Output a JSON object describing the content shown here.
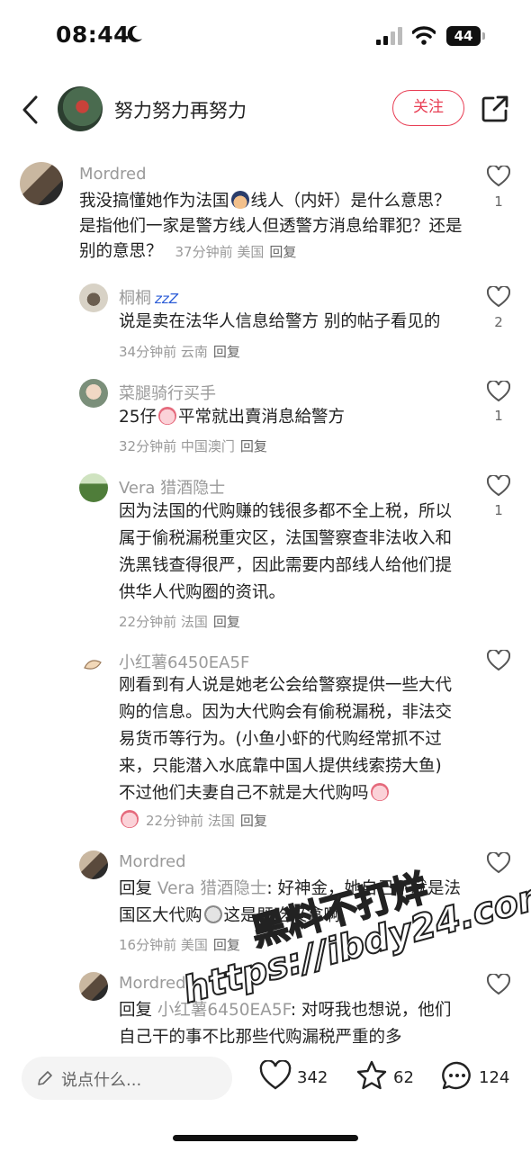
{
  "status": {
    "time": "08:44",
    "battery": "44"
  },
  "header": {
    "name": "努力努力再努力",
    "follow": "关注"
  },
  "comments": [
    {
      "name": "Mordred",
      "text": "我没搞懂她作为法国",
      "text_b": "线人（内奸）是什么意思？是指他们一家是警方线人但透警方消息给罪犯？还是别的意思？",
      "time": "37分钟前",
      "loc": "美国",
      "reply": "回复",
      "likes": "1"
    },
    {
      "name": "桐桐",
      "text": "说是卖在法华人信息给警方 别的帖子看见的",
      "time": "34分钟前",
      "loc": "云南",
      "reply": "回复",
      "likes": "2"
    },
    {
      "name": "菜腿骑行买手",
      "text": "25仔",
      "text_b": "平常就出賣消息給警方",
      "time": "32分钟前",
      "loc": "中国澳门",
      "reply": "回复",
      "likes": "1"
    },
    {
      "name": "Vera 猎酒隐士",
      "text": "因为法国的代购赚的钱很多都不全上税，所以属于偷税漏税重灾区，法国警察查非法收入和洗黑钱查得很严，因此需要内部线人给他们提供华人代购圈的资讯。",
      "time": "22分钟前",
      "loc": "法国",
      "reply": "回复",
      "likes": "1"
    },
    {
      "name": "小红薯6450EA5F",
      "text": "刚看到有人说是她老公会给警察提供一些大代购的信息。因为大代购会有偷税漏税，非法交易货币等行为。(小鱼小虾的代购经常抓不过来，只能潜入水底靠中国人提供线索捞大鱼) 不过他们夫妻自己不就是大代购吗",
      "time": "22分钟前",
      "loc": "法国",
      "reply": "回复",
      "likes": ""
    },
    {
      "name": "Mordred",
      "prefix": "回复",
      "target": "Vera 猎酒隐士",
      "text": ": 好神金，她自己不就是法国区大代购",
      "text_b": "这是既吃又拿啊",
      "time": "16分钟前",
      "loc": "美国",
      "reply": "回复",
      "likes": ""
    },
    {
      "name": "Mordred",
      "prefix": "回复",
      "target": "小红薯6450EA5F",
      "text": ": 对呀我也想说，他们自己干的事不比那些代购漏税严重的多",
      "likes": ""
    }
  ],
  "bottom": {
    "placeholder": "说点什么...",
    "likes": "342",
    "stars": "62",
    "comments": "124"
  },
  "watermark": {
    "line1": "黑料不打烊",
    "line2": "https://ibdy24.com"
  }
}
